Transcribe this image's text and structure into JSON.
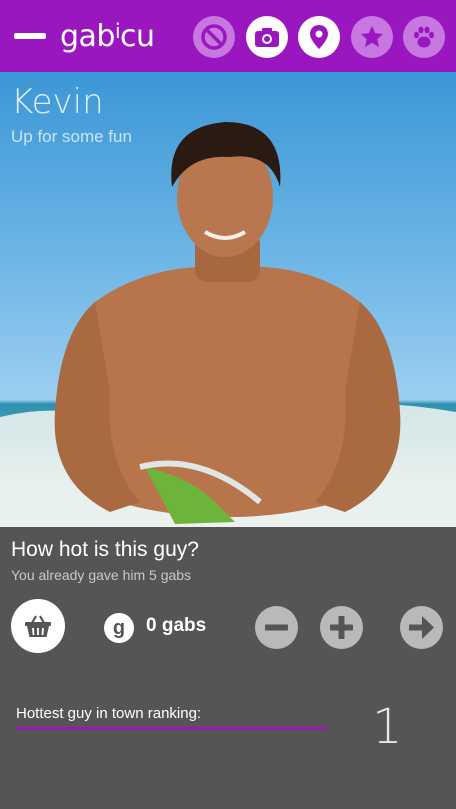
{
  "header": {
    "logo_part1": "gab",
    "logo_part2": "i",
    "logo_part3": "cu",
    "accent": "#9a17bf",
    "icons": [
      "block-icon",
      "camera-icon",
      "location-pin-icon",
      "star-icon",
      "paw-icon"
    ]
  },
  "profile": {
    "name": "Kevin",
    "tagline": "Up for some fun"
  },
  "rating": {
    "question": "How hot is this guy?",
    "gave_text": "You already gave him 5 gabs",
    "g_badge": "g",
    "gabs_label": "0 gabs"
  },
  "ranking": {
    "label": "Hottest guy in town ranking:",
    "value": "1"
  }
}
